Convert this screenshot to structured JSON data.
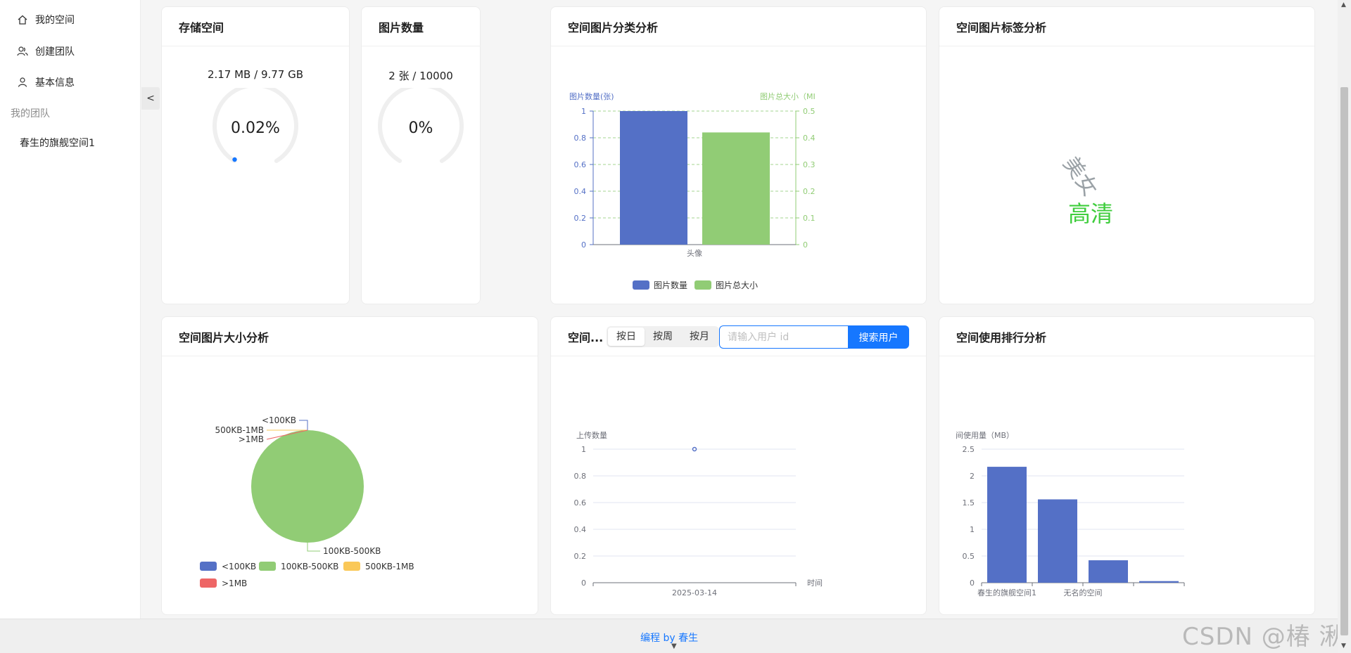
{
  "sidebar": {
    "items": [
      {
        "label": "我的空间",
        "icon": "home-icon"
      },
      {
        "label": "创建团队",
        "icon": "team-icon"
      },
      {
        "label": "基本信息",
        "icon": "user-icon"
      }
    ],
    "group_label": "我的团队",
    "group_items": [
      {
        "label": "春生的旗舰空间1"
      }
    ],
    "collapse_label": "<"
  },
  "cards": {
    "storage": {
      "title": "存储空间",
      "usage_text": "2.17 MB / 9.77 GB",
      "percent_label": "0.02%",
      "percent": 0.02
    },
    "count": {
      "title": "图片数量",
      "usage_text": "2 张 / 10000",
      "percent_label": "0%",
      "percent": 0
    },
    "category": {
      "title": "空间图片分类分析"
    },
    "tags": {
      "title": "空间图片标签分析",
      "words": [
        "美女",
        "高清"
      ]
    },
    "size": {
      "title": "空间图片大小分析"
    },
    "upload": {
      "title": "空间...",
      "segments": [
        "按日",
        "按周",
        "按月"
      ],
      "active_segment": "按日",
      "search_placeholder": "请输入用户 id",
      "search_value": "",
      "search_button": "搜索用户"
    },
    "rank": {
      "title": "空间使用排行分析"
    }
  },
  "chart_data": [
    {
      "type": "bar",
      "categories": [
        "头像"
      ],
      "series": [
        {
          "name": "图片数量",
          "values": [
            1
          ],
          "axis": "left",
          "color": "#5470c6"
        },
        {
          "name": "图片总大小",
          "values": [
            0.42
          ],
          "axis": "right",
          "color": "#91cc75"
        }
      ],
      "ylabel": "图片数量(张)",
      "ylabel_right": "图片总大小（MI",
      "ylim": [
        0,
        1
      ],
      "ylim_right": [
        0,
        0.5
      ],
      "yticks": [
        "0",
        "0.2",
        "0.4",
        "0.6",
        "0.8",
        "1"
      ],
      "yticks_right": [
        "0",
        "0.1",
        "0.2",
        "0.3",
        "0.4",
        "0.5"
      ],
      "legend": "bottom"
    },
    {
      "type": "pie",
      "slices": [
        {
          "name": "<100KB",
          "value": 0,
          "color": "#5470c6"
        },
        {
          "name": "100KB-500KB",
          "value": 2,
          "color": "#91cc75"
        },
        {
          "name": "500KB-1MB",
          "value": 0,
          "color": "#fac858"
        },
        {
          "name": ">1MB",
          "value": 0,
          "color": "#ee6666"
        }
      ],
      "legend": "bottom"
    },
    {
      "type": "line",
      "x": [
        "2025-03-14"
      ],
      "series": [
        {
          "values": [
            1
          ],
          "color": "#5470c6"
        }
      ],
      "xlabel": "时间",
      "ylabel": "上传数量",
      "ylim": [
        0,
        1
      ],
      "yticks": [
        "0",
        "0.2",
        "0.4",
        "0.6",
        "0.8",
        "1"
      ]
    },
    {
      "type": "bar",
      "categories": [
        "春生的旗舰空间1",
        "无名的空间",
        "",
        ""
      ],
      "series": [
        {
          "values": [
            2.17,
            1.56,
            0.42,
            0.03
          ],
          "color": "#5470c6"
        }
      ],
      "ylabel": "间使用量（MB）",
      "ylim": [
        0,
        2.5
      ],
      "yticks": [
        "0",
        "0.5",
        "1",
        "1.5",
        "2",
        "2.5"
      ]
    }
  ],
  "footer": {
    "text": "编程 by 春生",
    "watermark": "CSDN @椿  湫"
  }
}
